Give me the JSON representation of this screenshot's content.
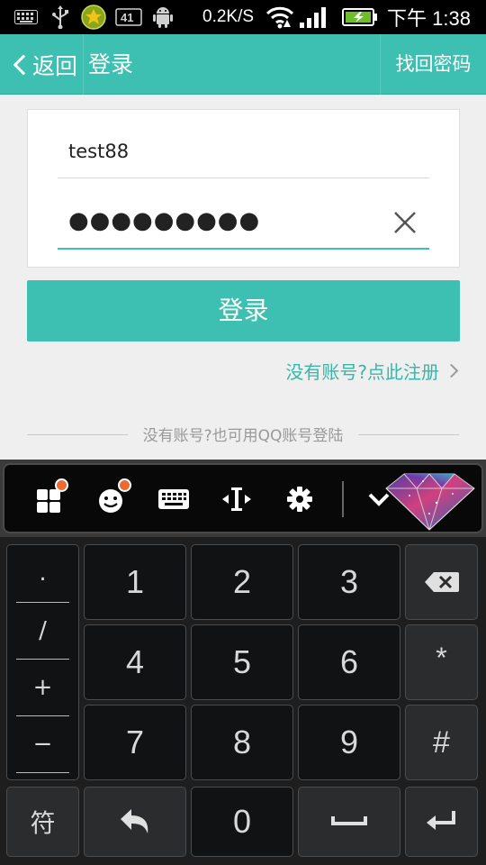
{
  "status_bar": {
    "network_speed": "0.2K/S",
    "time": "下午 1:38",
    "icons": [
      "keyboard-icon",
      "usb-icon",
      "app-icon",
      "sim-4g-icon",
      "android-icon",
      "wifi-icon",
      "signal-icon",
      "battery-charging-icon"
    ]
  },
  "title_bar": {
    "back_label": "返回",
    "title": "登录",
    "forgot_password": "找回密码"
  },
  "login_form": {
    "username_value": "test88",
    "password_masked": "●●●●●●●●●",
    "login_button": "登录",
    "register_link": "没有账号?点此注册",
    "qq_login_text": "没有账号?也可用QQ账号登陆"
  },
  "keyboard_toolbar": {
    "icons": [
      "apps-icon",
      "emoji-icon",
      "keyboard-icon",
      "cursor-move-icon",
      "settings-icon",
      "collapse-icon",
      "skin-diamond-icon"
    ]
  },
  "keyboard": {
    "symbols": [
      ".",
      "/",
      "+",
      "−"
    ],
    "symbol_mode_key": "符",
    "rows": [
      [
        "1",
        "2",
        "3"
      ],
      [
        "4",
        "5",
        "6"
      ],
      [
        "7",
        "8",
        "9"
      ]
    ],
    "star_key": "*",
    "hash_key": "#",
    "zero_key": "0"
  },
  "colors": {
    "accent": "#3dbfb2",
    "keyboard_bg": "#1e1e1e",
    "badge": "#ef6a2c"
  }
}
